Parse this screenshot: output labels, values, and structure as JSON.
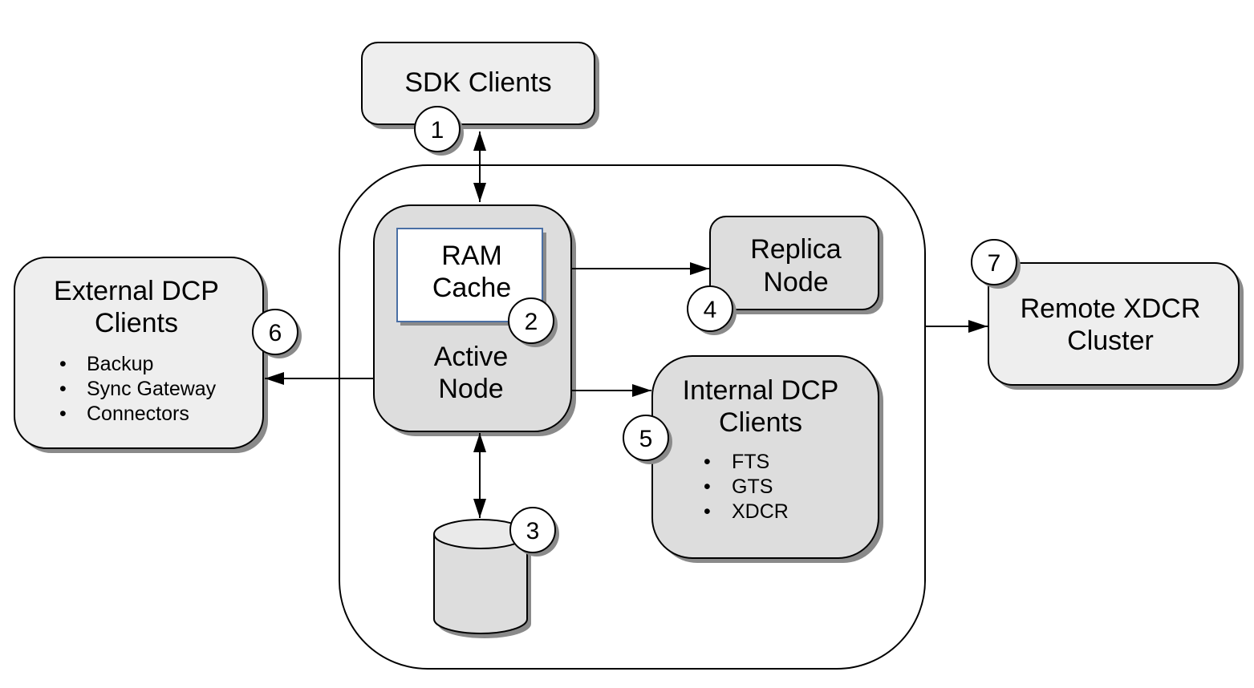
{
  "diagram": {
    "nodes": {
      "sdk_clients": {
        "label": "SDK Clients",
        "badge": "1"
      },
      "ram_cache": {
        "label_lines": [
          "RAM",
          "Cache"
        ],
        "badge": "2"
      },
      "active_node": {
        "label_lines": [
          "Active",
          "Node"
        ]
      },
      "storage": {
        "badge": "3"
      },
      "replica_node": {
        "label_lines": [
          "Replica",
          "Node"
        ],
        "badge": "4"
      },
      "internal_dcp": {
        "label_lines": [
          "Internal DCP",
          "Clients"
        ],
        "items": [
          "FTS",
          "GTS",
          "XDCR"
        ],
        "badge": "5"
      },
      "external_dcp": {
        "label_lines": [
          "External DCP",
          "Clients"
        ],
        "items": [
          "Backup",
          "Sync Gateway",
          "Connectors"
        ],
        "badge": "6"
      },
      "remote_xdcr": {
        "label_lines": [
          "Remote XDCR",
          "Cluster"
        ],
        "badge": "7"
      }
    },
    "bullet_char": "•",
    "colors": {
      "box_light": "#eeeeee",
      "box_mid": "#dddddd",
      "shadow": "#8a8a8a",
      "stroke": "#000000",
      "ram_border": "#4a6fa5"
    }
  }
}
